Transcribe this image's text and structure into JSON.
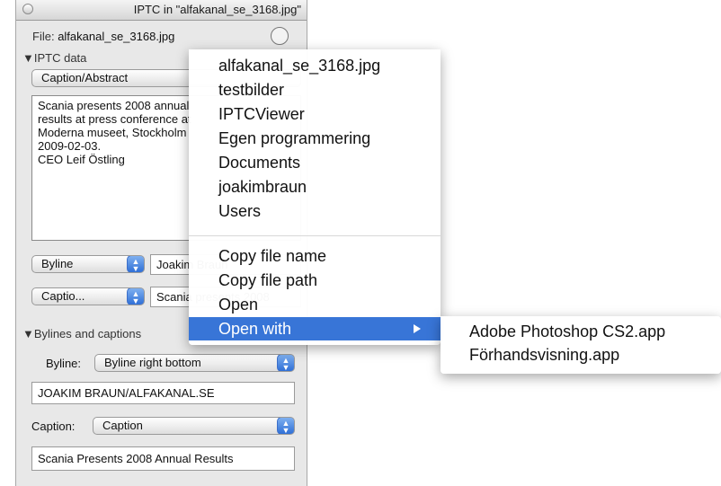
{
  "window": {
    "title": "IPTC in \"alfakanal_se_3168.jpg\"",
    "file_label": "File:",
    "file_value": "alfakanal_se_3168.jpg"
  },
  "iptc": {
    "section_label": "▼IPTC data",
    "field_select": "Caption/Abstract",
    "text_lines": [
      "Scania presents 2008 annual",
      "results at press conference at",
      "Moderna museet, Stockholm",
      "2009-02-03.",
      "CEO Leif Östling"
    ],
    "byline_select": "Byline",
    "byline_value": "Joakim Braun",
    "caption_select": "Captio...",
    "caption_value": "Scania presents 2008"
  },
  "bylines": {
    "section_label": "▼Bylines and captions",
    "byline_label": "Byline:",
    "byline_select": "Byline right bottom",
    "byline_field": "JOAKIM BRAUN/ALFAKANAL.SE",
    "caption_label": "Caption:",
    "caption_select": "Caption",
    "caption_field": "Scania Presents 2008 Annual Results"
  },
  "menu": {
    "path_items": [
      "alfakanal_se_3168.jpg",
      "testbilder",
      "IPTCViewer",
      "Egen programmering",
      "Documents",
      "joakimbraun",
      "Users"
    ],
    "copy_name": "Copy file name",
    "copy_path": "Copy file path",
    "open": "Open",
    "open_with": "Open with"
  },
  "submenu": {
    "items": [
      "Adobe Photoshop CS2.app",
      "Förhandsvisning.app"
    ]
  },
  "colors": {
    "selection": "#3875d7",
    "stepper": "#2f6fd6"
  }
}
